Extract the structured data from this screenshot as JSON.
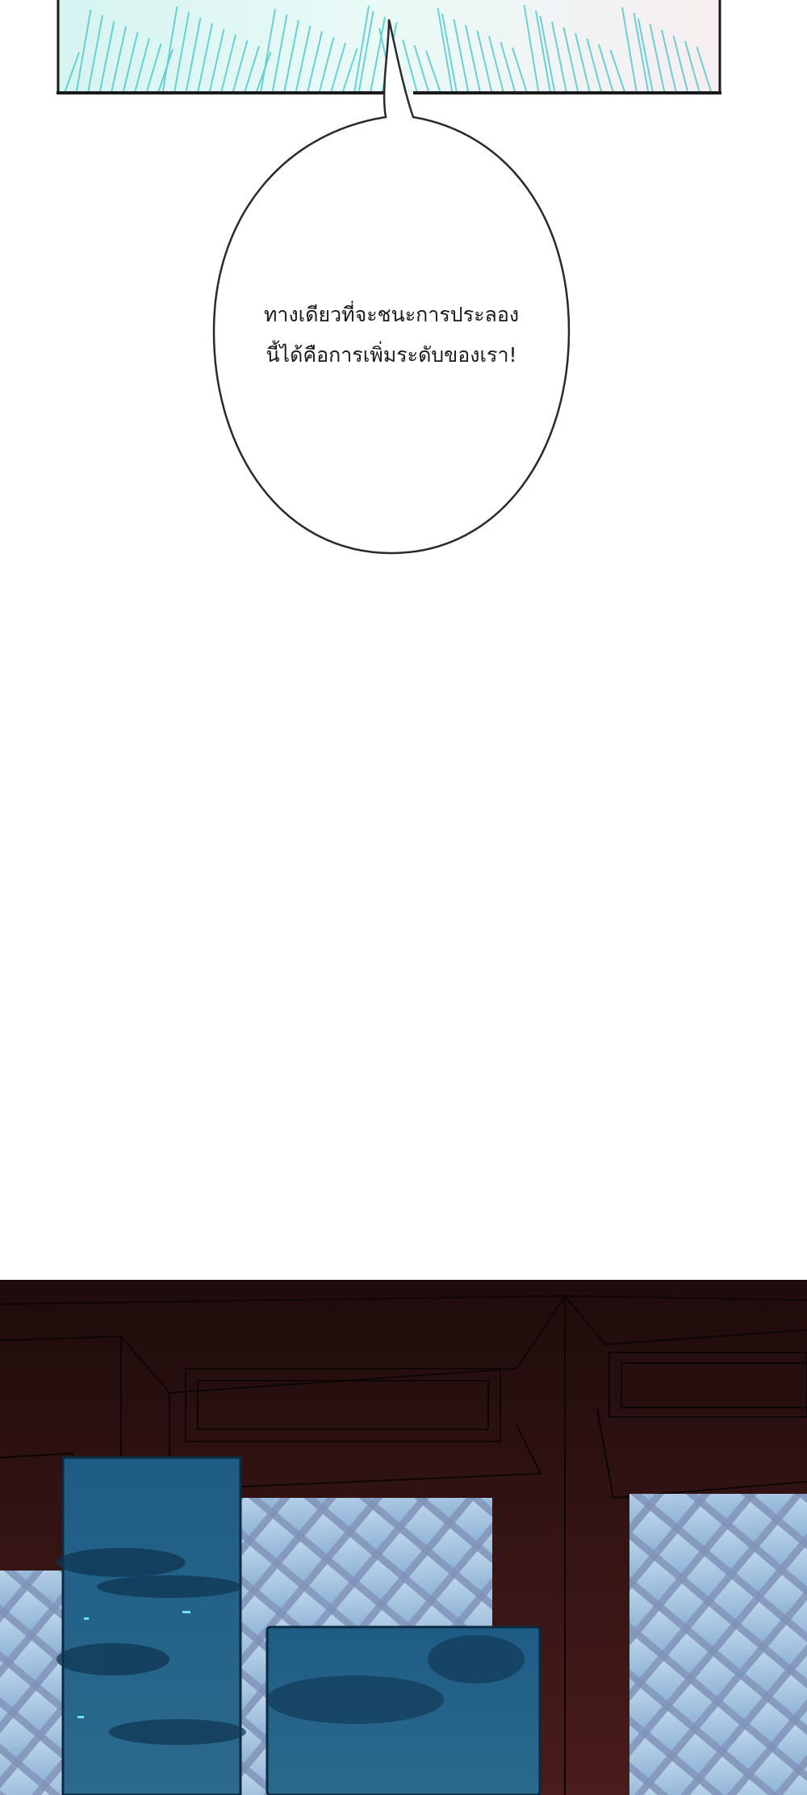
{
  "speech_bubble": {
    "lines": [
      "ทางเดียวที่จะชนะการประลอง",
      "นี้ได้คือการเพิ่มระดับของเรา!"
    ]
  },
  "colors": {
    "page_background": "#ffffff",
    "top_panel_tint": "#c6eeee",
    "speed_lines": "#3fc3c8",
    "room_wood": "#3a1414",
    "window_glass": "#9fc3e2",
    "night_sky": "#1b4a6e"
  }
}
